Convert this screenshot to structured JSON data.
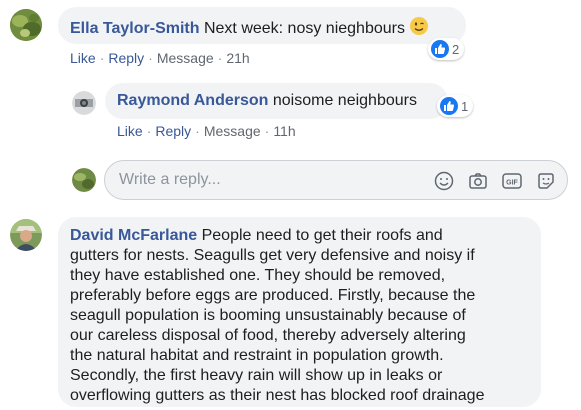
{
  "comments": [
    {
      "author": "Ella Taylor-Smith",
      "text": "Next week: nosy nieghbours",
      "actions": {
        "like": "Like",
        "reply": "Reply",
        "message": "Message",
        "time": "21h"
      },
      "reactions": 2
    },
    {
      "author": "Raymond Anderson",
      "text": "noisome neighbours",
      "actions": {
        "like": "Like",
        "reply": "Reply",
        "message": "Message",
        "time": "11h"
      },
      "reactions": 1
    },
    {
      "author": "David McFarlane",
      "lines": [
        " People need to get their roofs and",
        "gutters for nests. Seagulls get very defensive and noisy if",
        "they have established one. They should be removed,",
        "preferably before eggs are produced. Firstly, because the",
        "seagull population is booming unsustainably because of",
        "our careless disposal of food, thereby adversely altering",
        "the natural habitat and restraint in population growth.",
        "Secondly, the first heavy rain will show up in leaks or",
        "overflowing gutters as their nest has blocked roof drainage"
      ]
    }
  ],
  "reply_box": {
    "placeholder": "Write a reply...",
    "icons": [
      "emoji-icon",
      "camera-icon",
      "gif-icon",
      "sticker-icon"
    ],
    "gif_label": "GIF"
  },
  "colors": {
    "author": "#385898",
    "bubble": "#f2f3f5",
    "like": "#1877f2",
    "meta": "#606770"
  }
}
